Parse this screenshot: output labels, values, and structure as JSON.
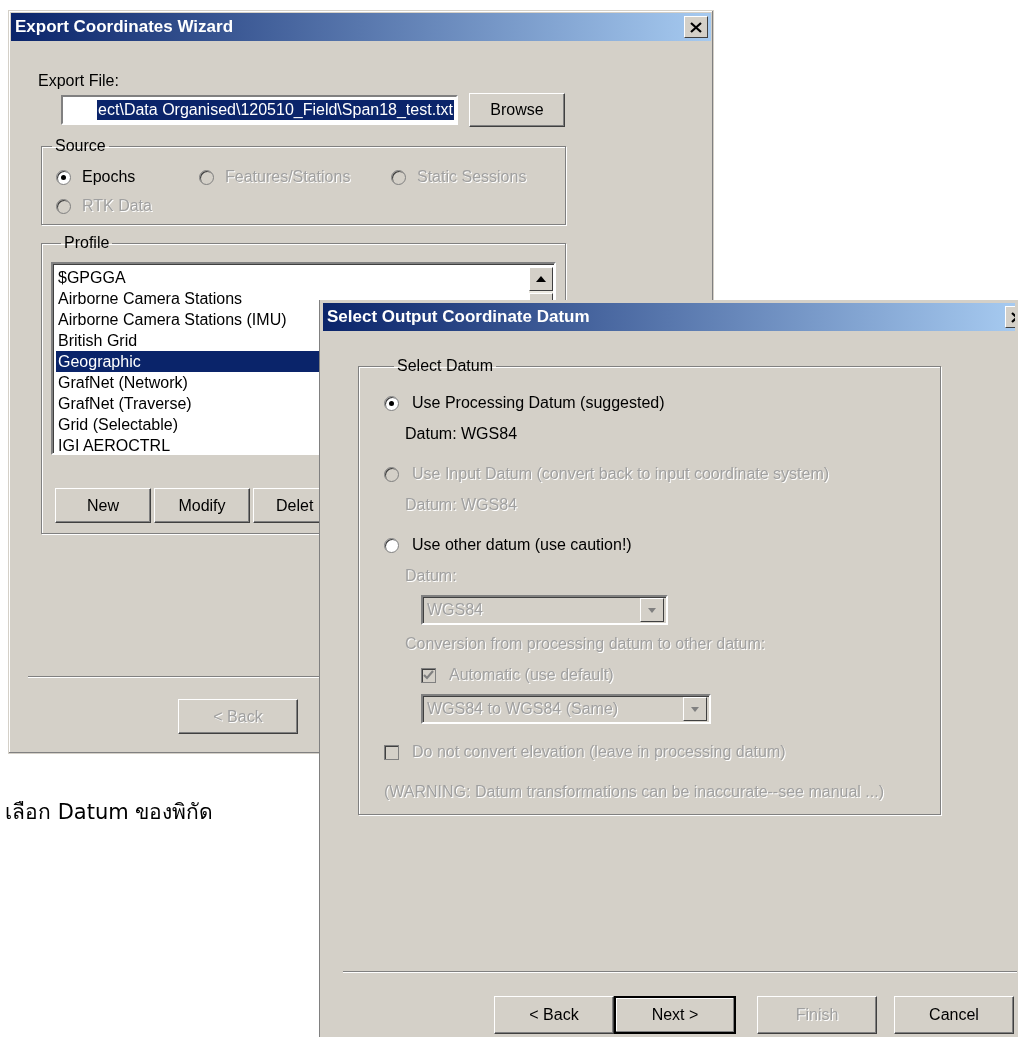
{
  "export_wizard": {
    "title": "Export Coordinates Wizard",
    "export_file": {
      "label": "Export File:",
      "value": "ect\\Data Organised\\120510_Field\\Span18_test.txt",
      "text_selected": true
    },
    "browse_button": "Browse",
    "source": {
      "legend": "Source",
      "options": [
        {
          "label": "Epochs",
          "selected": true,
          "disabled": false
        },
        {
          "label": "Features/Stations",
          "selected": false,
          "disabled": true
        },
        {
          "label": "Static Sessions",
          "selected": false,
          "disabled": true
        },
        {
          "label": "RTK Data",
          "selected": false,
          "disabled": true
        }
      ]
    },
    "profile": {
      "legend": "Profile",
      "items": [
        {
          "label": "$GPGGA",
          "selected": false
        },
        {
          "label": "Airborne Camera Stations",
          "selected": false
        },
        {
          "label": "Airborne Camera Stations (IMU)",
          "selected": false
        },
        {
          "label": "British Grid",
          "selected": false
        },
        {
          "label": "Geographic",
          "selected": true
        },
        {
          "label": "GrafNet (Network)",
          "selected": false
        },
        {
          "label": "GrafNet (Traverse)",
          "selected": false
        },
        {
          "label": "Grid (Selectable)",
          "selected": false
        },
        {
          "label": "IGI AEROCTRL",
          "selected": false
        }
      ],
      "buttons": [
        "New",
        "Modify",
        "Delet"
      ]
    },
    "nav_buttons": [
      {
        "label": "< Back",
        "disabled": true
      }
    ]
  },
  "caption": "เลือก Datum ของพิกัด",
  "datum_dialog": {
    "title": "Select Output Coordinate Datum",
    "group": {
      "legend": "Select Datum",
      "rows": [
        {
          "kind": "radio",
          "label": "Use Processing Datum (suggested)",
          "selected": true,
          "disabled": false,
          "children": [
            {
              "kind": "text",
              "text": "Datum: WGS84",
              "disabled": false
            }
          ]
        },
        {
          "kind": "radio",
          "label": "Use Input Datum (convert back to input coordinate system)",
          "selected": false,
          "disabled": true,
          "children": [
            {
              "kind": "text",
              "text": "Datum: WGS84",
              "disabled": true
            }
          ]
        },
        {
          "kind": "radio",
          "label": "Use other datum (use caution!)",
          "selected": false,
          "disabled": false,
          "children": [
            {
              "kind": "text",
              "text": "Datum:",
              "disabled": true,
              "children": [
                {
                  "kind": "combo",
                  "value": "WGS84",
                  "disabled": true
                }
              ]
            },
            {
              "kind": "text",
              "text": "Conversion from processing datum to other datum:",
              "disabled": true,
              "children": [
                {
                  "kind": "checkbox",
                  "label": "Automatic (use default)",
                  "checked": true,
                  "disabled": true
                },
                {
                  "kind": "combo",
                  "value": "WGS84 to WGS84 (Same)",
                  "disabled": true
                }
              ]
            }
          ]
        },
        {
          "kind": "checkbox",
          "label": "Do not convert elevation (leave in processing datum)",
          "checked": false,
          "disabled": true
        },
        {
          "kind": "text",
          "text": "(WARNING: Datum transformations can be inaccurate--see manual ...)",
          "disabled": true
        }
      ]
    },
    "buttons": [
      {
        "label": "< Back",
        "disabled": false,
        "default": false
      },
      {
        "label": "Next >",
        "disabled": false,
        "default": true
      },
      {
        "label": "Finish",
        "disabled": true,
        "default": false
      },
      {
        "label": "Cancel",
        "disabled": false,
        "default": false
      }
    ]
  }
}
